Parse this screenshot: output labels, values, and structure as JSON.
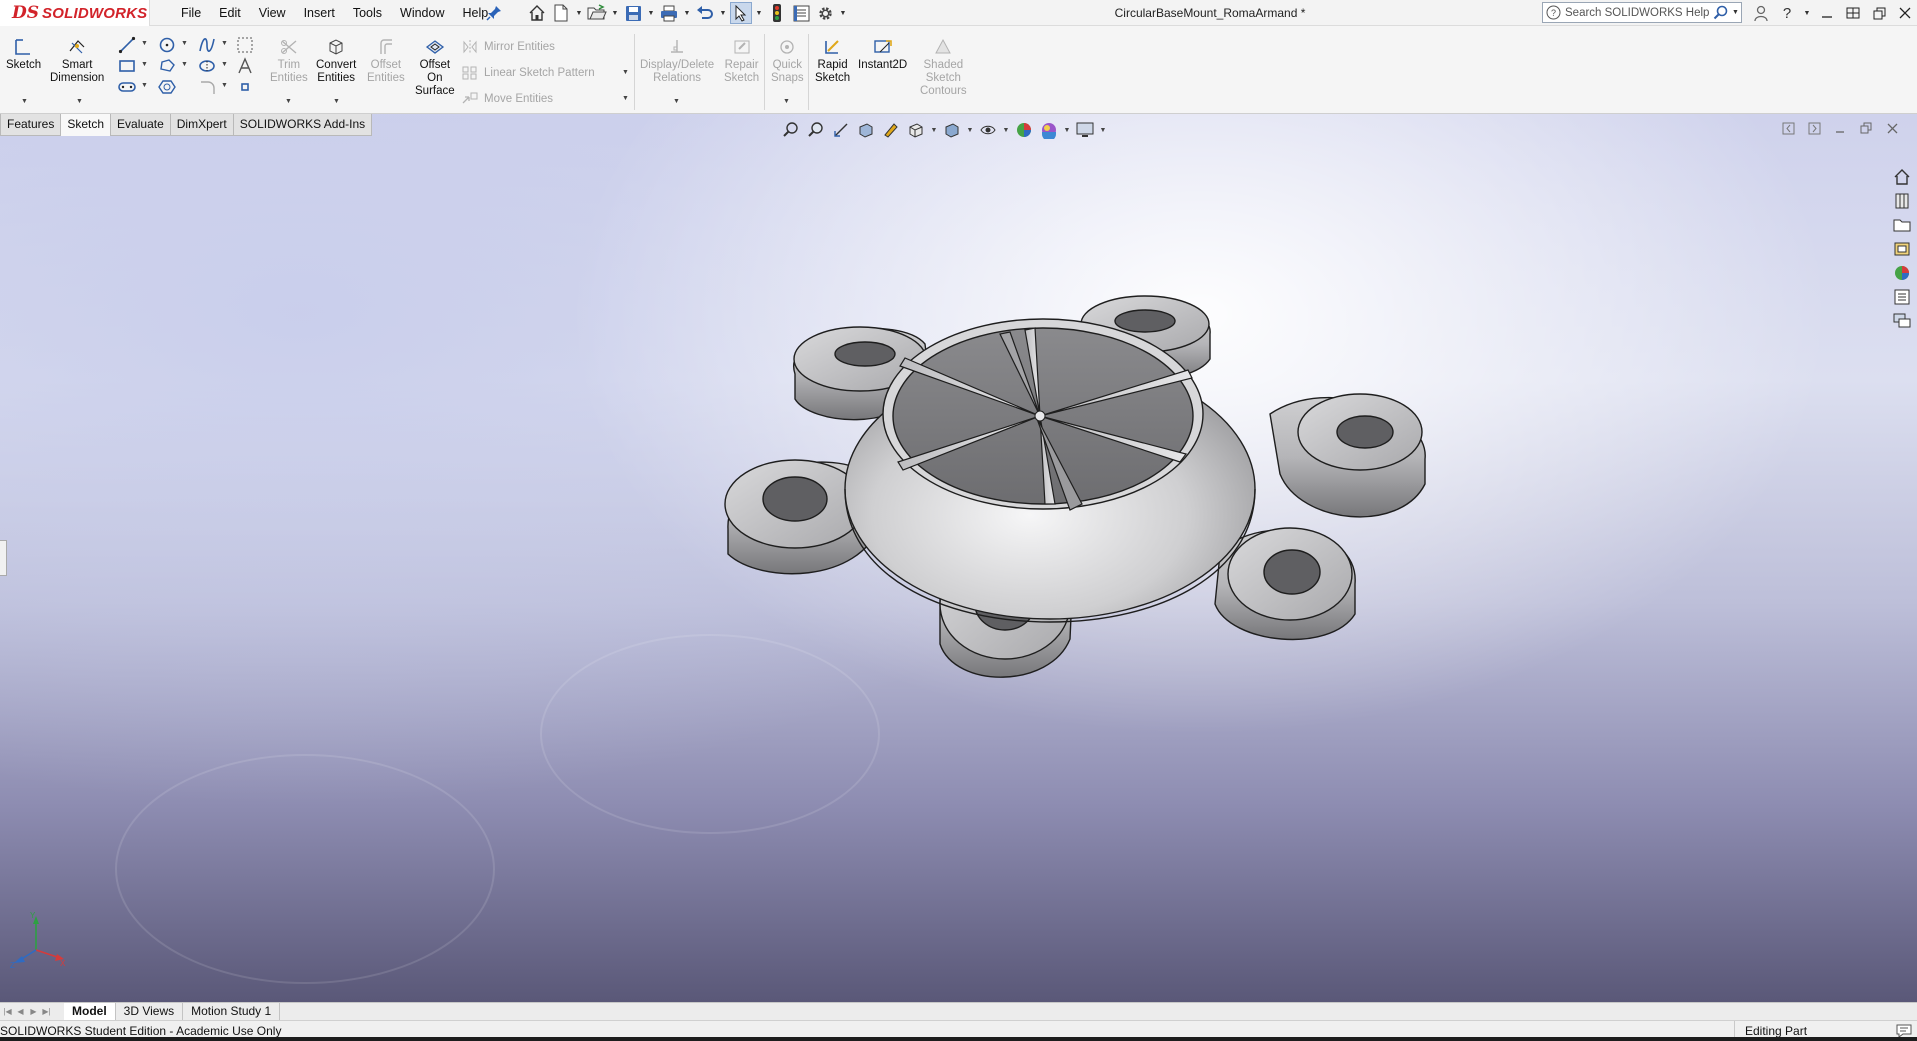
{
  "app": {
    "brand_prefix": "DS",
    "brand_name": "SOLIDWORKS",
    "document_title": "CircularBaseMount_RomaArmand *",
    "search_placeholder": "Search SOLIDWORKS Help"
  },
  "menu": [
    "File",
    "Edit",
    "View",
    "Insert",
    "Tools",
    "Window",
    "Help"
  ],
  "command_manager": {
    "sketch": "Sketch",
    "smart_dimension": [
      "Smart",
      "Dimension"
    ],
    "trim_entities": [
      "Trim",
      "Entities"
    ],
    "convert_entities": [
      "Convert",
      "Entities"
    ],
    "offset_entities": [
      "Offset",
      "Entities"
    ],
    "offset_on_surface": [
      "Offset",
      "On",
      "Surface"
    ],
    "mirror_entities": "Mirror Entities",
    "linear_sketch_pattern": "Linear Sketch Pattern",
    "move_entities": "Move Entities",
    "display_delete_relations": [
      "Display/Delete",
      "Relations"
    ],
    "repair_sketch": [
      "Repair",
      "Sketch"
    ],
    "quick_snaps": [
      "Quick",
      "Snaps"
    ],
    "rapid_sketch": [
      "Rapid",
      "Sketch"
    ],
    "instant2d": "Instant2D",
    "shaded_sketch_contours": [
      "Shaded",
      "Sketch",
      "Contours"
    ]
  },
  "tabs": {
    "items": [
      "Features",
      "Sketch",
      "Evaluate",
      "DimXpert",
      "SOLIDWORKS Add-Ins"
    ],
    "active": "Sketch"
  },
  "bottom_tabs": {
    "items": [
      "Model",
      "3D Views",
      "Motion Study 1"
    ],
    "active": "Model"
  },
  "status": {
    "left": "SOLIDWORKS Student Edition - Academic Use Only",
    "right": "Editing Part"
  },
  "colors": {
    "brand_red": "#d2232a",
    "part_light": "#e9e9ea",
    "part_mid": "#b7b7b9",
    "part_dark": "#6f6f72",
    "edge": "#1e1e1e"
  },
  "icons": {
    "viewport_triad": "axis-triad-icon"
  }
}
